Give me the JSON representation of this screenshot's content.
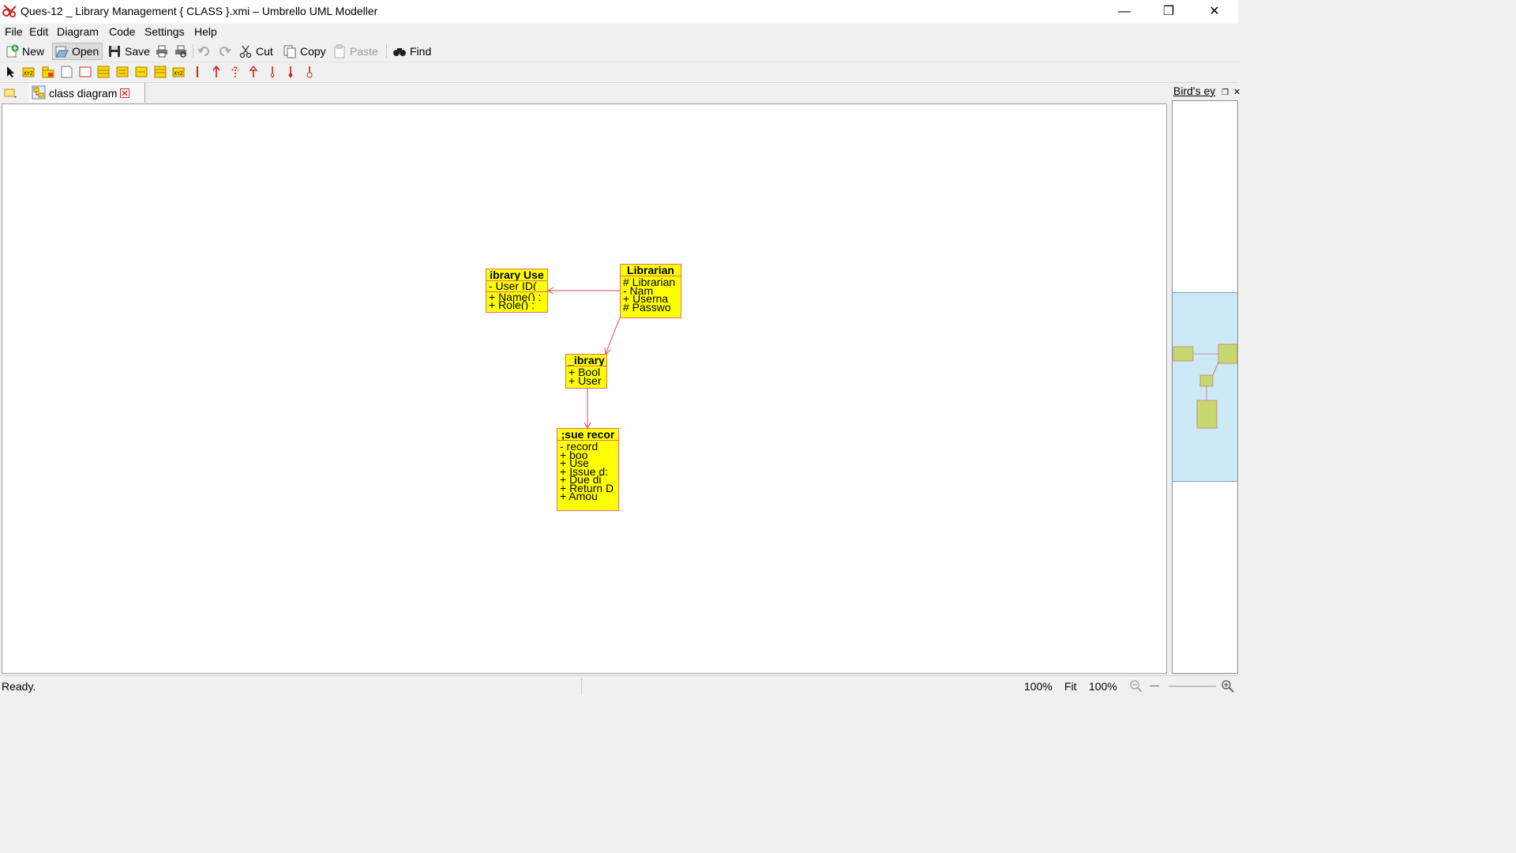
{
  "window": {
    "title": "Ques-12 _ Library Management { CLASS }.xmi – Umbrello UML Modeller",
    "controls": {
      "minimize": "—",
      "restore": "❐",
      "close": "✕"
    }
  },
  "menu": [
    "File",
    "Edit",
    "Diagram",
    "Code",
    "Settings",
    "Help"
  ],
  "toolbar": {
    "new": "New",
    "open": "Open",
    "save": "Save",
    "cut": "Cut",
    "copy": "Copy",
    "paste": "Paste",
    "find": "Find"
  },
  "tab": {
    "label": "class diagram"
  },
  "birds_eye": {
    "title": "Bird's ey"
  },
  "diagram": {
    "classes": {
      "library_user": {
        "name": "ibrary Use",
        "attributes": [
          "- User ID("
        ],
        "operations": [
          "+ Name() :",
          "+ Role() :"
        ]
      },
      "librarian": {
        "name": "Librarian",
        "attributes": [
          "# Librarian",
          "- Nam",
          "+ Userna",
          "# Passwo"
        ],
        "operations": []
      },
      "library": {
        "name": "_ibrary",
        "attributes": [
          "+ Bool",
          "+ User"
        ],
        "operations": []
      },
      "issue_record": {
        "name": ";sue recor",
        "attributes": [
          "- record",
          "+ boo",
          "+ Use",
          "+ Issue d:",
          "+ Due di",
          "+ Return D",
          "+ Amou"
        ],
        "operations": []
      }
    }
  },
  "status": {
    "message": "Ready.",
    "zoom": "100%",
    "fit": "Fit",
    "zoom2": "100%"
  },
  "colors": {
    "class_fill": "#ffff00",
    "class_border": "#e07070",
    "association": "#e04040",
    "birds_eye_view": "#cde8f6"
  }
}
